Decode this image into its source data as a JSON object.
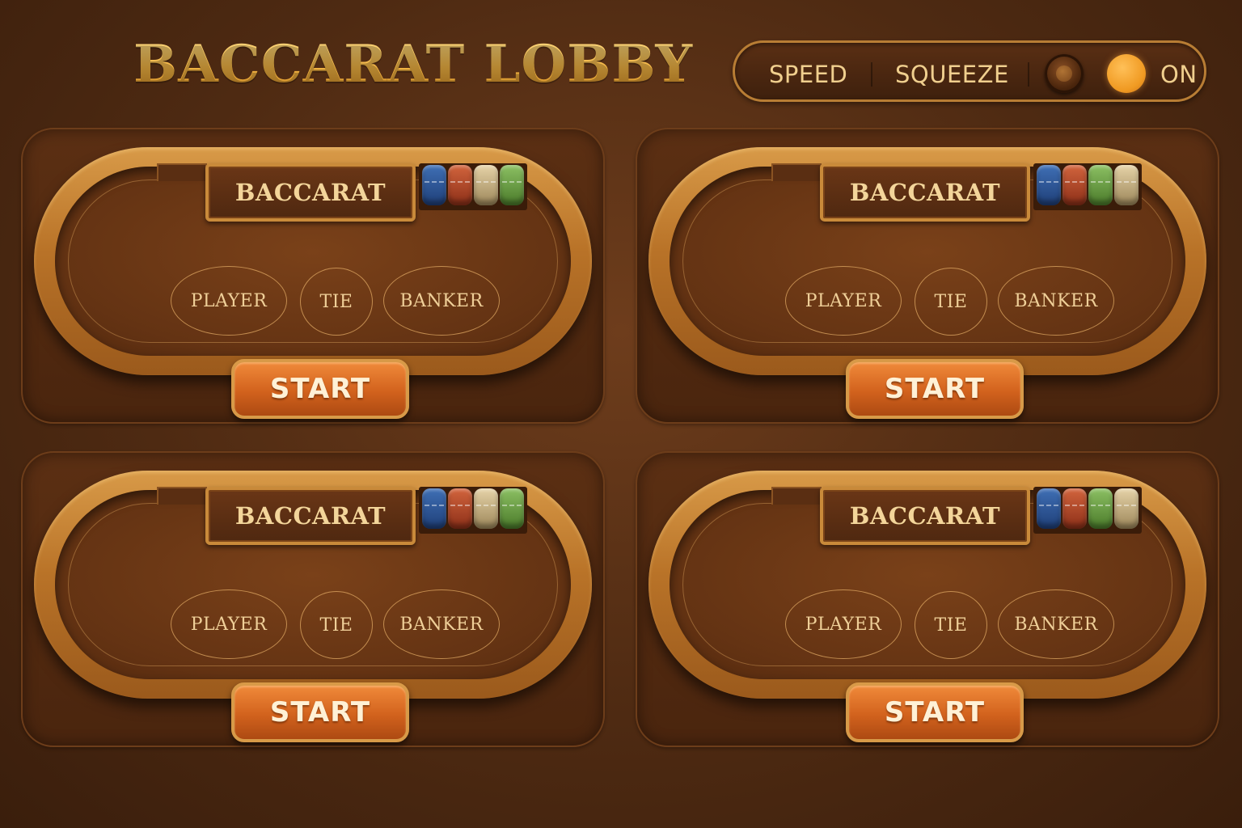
{
  "header": {
    "title": "BACCARAT LOBBY"
  },
  "mode_bar": {
    "speed_label": "SPEED",
    "squeeze_label": "SQUEEZE",
    "toggle_label": "ON"
  },
  "tables": [
    {
      "sign": "BACCARAT",
      "bets": [
        "PLAYER",
        "TIE",
        "BANKER"
      ],
      "start_label": "START",
      "chip_colors": [
        "#2e55a0",
        "#c04a28",
        "#d9c493",
        "#6fa847"
      ]
    },
    {
      "sign": "BACCARAT",
      "bets": [
        "PLAYER",
        "TIE",
        "BANKER"
      ],
      "start_label": "START",
      "chip_colors": [
        "#2e55a0",
        "#c04a28",
        "#6fa847",
        "#d9c493"
      ]
    },
    {
      "sign": "BACCARAT",
      "bets": [
        "PLAYER",
        "TIE",
        "BANKER"
      ],
      "start_label": "START",
      "chip_colors": [
        "#2e55a0",
        "#c04a28",
        "#d9c493",
        "#6fa847"
      ]
    },
    {
      "sign": "BACCARAT",
      "bets": [
        "PLAYER",
        "TIE",
        "BANKER"
      ],
      "start_label": "START",
      "chip_colors": [
        "#2e55a0",
        "#c04a28",
        "#6fa847",
        "#d9c493"
      ]
    }
  ],
  "colors": {
    "background": "#5a2f14",
    "accent_gold": "#f2b443",
    "start_button": "#d2621d",
    "toggle_on": "#f09a22"
  }
}
